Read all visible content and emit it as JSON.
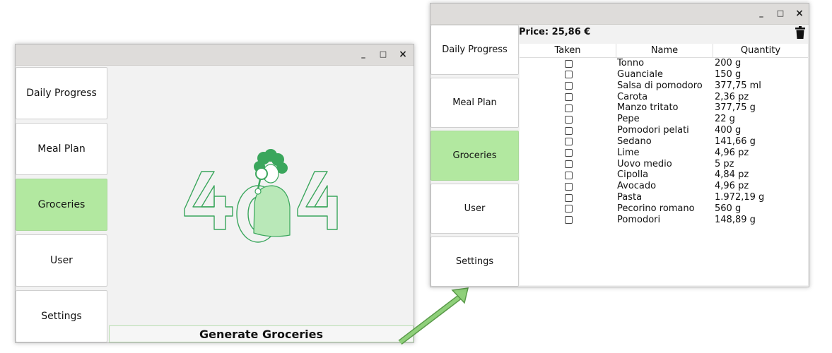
{
  "left_window": {
    "controls": {
      "minimize": "_",
      "maximize": "□",
      "close": "×"
    },
    "nav": [
      {
        "label": "Daily Progress",
        "active": false
      },
      {
        "label": "Meal Plan",
        "active": false
      },
      {
        "label": "Groceries",
        "active": true
      },
      {
        "label": "User",
        "active": false
      },
      {
        "label": "Settings",
        "active": false
      }
    ],
    "illustration": "404-not-found-illustration",
    "generate_button": "Generate Groceries"
  },
  "right_window": {
    "controls": {
      "minimize": "_",
      "maximize": "□",
      "close": "×"
    },
    "nav": [
      {
        "label": "Daily Progress",
        "active": false
      },
      {
        "label": "Meal Plan",
        "active": false
      },
      {
        "label": "Groceries",
        "active": true
      },
      {
        "label": "User",
        "active": false
      },
      {
        "label": "Settings",
        "active": false
      }
    ],
    "price": "Price: 25,86 €",
    "trash_icon": "trash-icon",
    "table": {
      "columns": [
        "Taken",
        "Name",
        "Quantity"
      ],
      "rows": [
        {
          "name": "Tonno",
          "quantity": "200 g"
        },
        {
          "name": "Guanciale",
          "quantity": "150 g"
        },
        {
          "name": "Salsa di pomodoro",
          "quantity": "377,75 ml"
        },
        {
          "name": "Carota",
          "quantity": "2,36 pz"
        },
        {
          "name": "Manzo tritato",
          "quantity": "377,75 g"
        },
        {
          "name": "Pepe",
          "quantity": "22 g"
        },
        {
          "name": "Pomodori pelati",
          "quantity": "400 g"
        },
        {
          "name": "Sedano",
          "quantity": "141,66 g"
        },
        {
          "name": "Lime",
          "quantity": "4,96 pz"
        },
        {
          "name": "Uovo medio",
          "quantity": "5 pz"
        },
        {
          "name": "Cipolla",
          "quantity": "4,84 pz"
        },
        {
          "name": "Avocado",
          "quantity": "4,96 pz"
        },
        {
          "name": "Pasta",
          "quantity": "1.972,19 g"
        },
        {
          "name": "Pecorino romano",
          "quantity": "560 g"
        },
        {
          "name": "Pomodori",
          "quantity": "148,89 g"
        }
      ]
    }
  },
  "colors": {
    "accent_green": "#b2e8a0",
    "illustration_green": "#3aa65c",
    "arrow_green": "#8fd07a"
  }
}
